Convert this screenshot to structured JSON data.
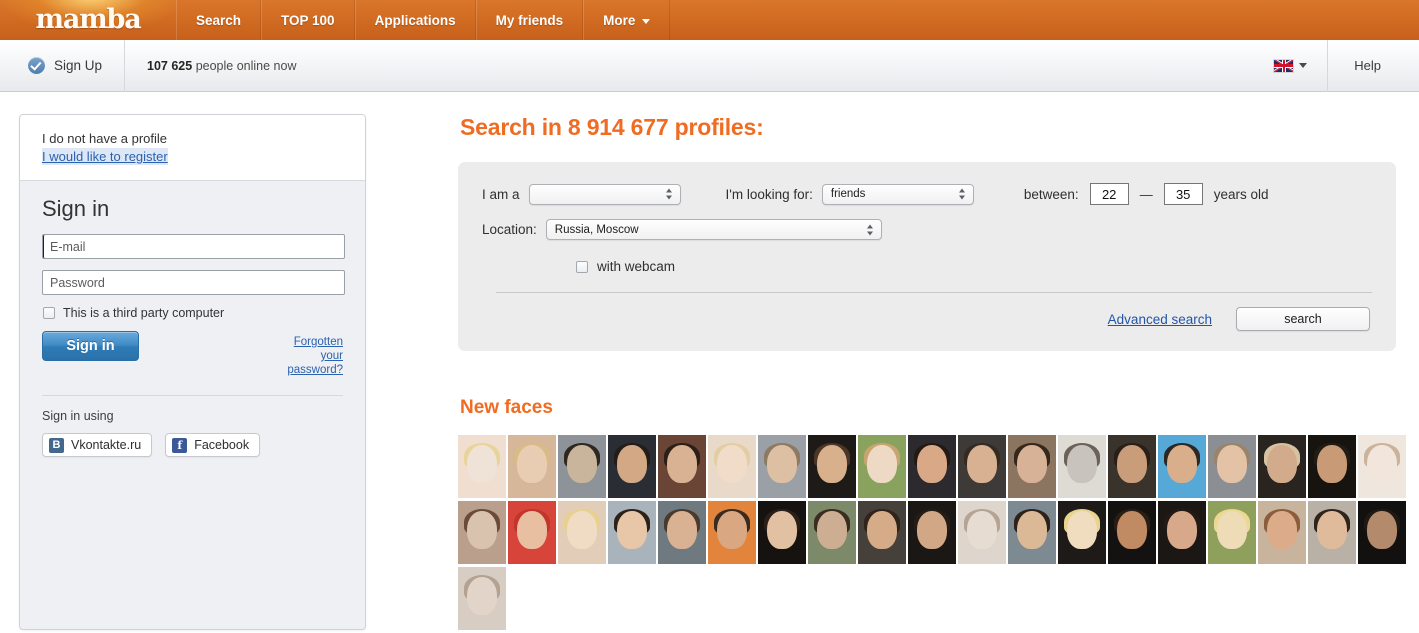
{
  "nav": {
    "logo": "mamba",
    "items": [
      {
        "label": "Search",
        "icon": null
      },
      {
        "label": "TOP 100",
        "icon": null
      },
      {
        "label": "Applications",
        "icon": null
      },
      {
        "label": "My friends",
        "icon": null
      },
      {
        "label": "More",
        "icon": "chevron-down-icon"
      }
    ]
  },
  "subbar": {
    "signup_label": "Sign Up",
    "signup_icon": "check-circle-icon",
    "online_count": "107 625",
    "online_text": "people online now",
    "lang_icon": "uk-flag-icon",
    "lang_caret_icon": "chevron-down-icon",
    "help_label": "Help"
  },
  "login": {
    "no_profile_text": "I do not have a profile",
    "register_link": "I would like to register",
    "title": "Sign in",
    "email_placeholder": "E-mail",
    "email_value": "",
    "password_placeholder": "Password",
    "password_value": "",
    "third_party_label": "This is a third party computer",
    "third_party_checked": false,
    "signin_button": "Sign in",
    "forgotten_link": "Forgotten your password?",
    "sign_in_using": "Sign in using",
    "social": [
      {
        "label": "Vkontakte.ru",
        "glyph": "B",
        "icon": "vkontakte-icon"
      },
      {
        "label": "Facebook",
        "glyph": "f",
        "icon": "facebook-icon"
      }
    ]
  },
  "search": {
    "title": "Search in 8 914 677 profiles:",
    "profiles_count": "8 914 677",
    "i_am_a_label": "I am a",
    "i_am_a_value": "",
    "looking_for_label": "I'm looking for:",
    "looking_for_value": "friends",
    "between_label": "between:",
    "age_from": "22",
    "age_dash": "—",
    "age_to": "35",
    "years_old_label": "years old",
    "location_label": "Location:",
    "location_value": "Russia, Moscow",
    "webcam_label": "with webcam",
    "webcam_checked": false,
    "advanced_link": "Advanced search",
    "search_button": "search"
  },
  "new_faces": {
    "title": "New faces",
    "thumbnails": [
      {
        "id": 1,
        "skin": "#efe2d6",
        "hair": "#e8d49a",
        "body": "#f0dfd0",
        "highlight": false
      },
      {
        "id": 2,
        "skin": "#e9cdb3",
        "hair": "#d9bb85",
        "body": "#d7b79a",
        "highlight": false
      },
      {
        "id": 3,
        "skin": "#c9b49c",
        "hair": "#2e2820",
        "body": "#8e9299",
        "highlight": false
      },
      {
        "id": 4,
        "skin": "#d3a884",
        "hair": "#241c16",
        "body": "#2a2d33",
        "highlight": true
      },
      {
        "id": 5,
        "skin": "#d8b292",
        "hair": "#2b1f18",
        "body": "#6a4434",
        "highlight": false
      },
      {
        "id": 6,
        "skin": "#f0dcc9",
        "hair": "#e3cda4",
        "body": "#e8d9c9",
        "highlight": false
      },
      {
        "id": 7,
        "skin": "#ddbfa4",
        "hair": "#8d7a62",
        "body": "#9aa0a6",
        "highlight": false
      },
      {
        "id": 8,
        "skin": "#d8b08c",
        "hair": "#4b3526",
        "body": "#1e1a17",
        "highlight": false
      },
      {
        "id": 9,
        "skin": "#eedac4",
        "hair": "#c8a470",
        "body": "#89a35e",
        "highlight": true
      },
      {
        "id": 10,
        "skin": "#d8a887",
        "hair": "#231a14",
        "body": "#2c2a2e",
        "highlight": true
      },
      {
        "id": 11,
        "skin": "#d7b191",
        "hair": "#342a22",
        "body": "#3d3a38",
        "highlight": false
      },
      {
        "id": 12,
        "skin": "#d8b296",
        "hair": "#35271c",
        "body": "#8c7560",
        "highlight": false
      },
      {
        "id": 13,
        "skin": "#c8c3bc",
        "hair": "#6a6158",
        "body": "#dedad4",
        "highlight": false
      },
      {
        "id": 14,
        "skin": "#c99d79",
        "hair": "#2a1f18",
        "body": "#3a332c",
        "highlight": false
      },
      {
        "id": 15,
        "skin": "#d8ae8b",
        "hair": "#2b2723",
        "body": "#56a8d6",
        "highlight": false
      },
      {
        "id": 16,
        "skin": "#e4c2a6",
        "hair": "#9a8469",
        "body": "#8b8f94",
        "highlight": false
      },
      {
        "id": 17,
        "skin": "#d2ab8c",
        "hair": "#d6c3a4",
        "body": "#2a2420",
        "highlight": false
      },
      {
        "id": 18,
        "skin": "#c89a76",
        "hair": "#241b15",
        "body": "#17140f",
        "highlight": true
      },
      {
        "id": 19,
        "skin": "#f2e6dc",
        "hair": "#cbb39b",
        "body": "#efe6de",
        "highlight": false
      },
      {
        "id": 20,
        "skin": "#d9c2ae",
        "hair": "#6a4b38",
        "body": "#b99f8c",
        "highlight": false
      },
      {
        "id": 21,
        "skin": "#e8bfa0",
        "hair": "#c2352c",
        "body": "#d6443a",
        "highlight": false
      },
      {
        "id": 22,
        "skin": "#f0dcc4",
        "hair": "#ead08f",
        "body": "#e2cdb8",
        "highlight": false
      },
      {
        "id": 23,
        "skin": "#e7c7a8",
        "hair": "#2d2219",
        "body": "#a9b3bb",
        "highlight": false
      },
      {
        "id": 24,
        "skin": "#d9b193",
        "hair": "#4a3a2c",
        "body": "#6f7a80",
        "highlight": false
      },
      {
        "id": 25,
        "skin": "#d9a781",
        "hair": "#3a2b20",
        "body": "#e2843c",
        "highlight": true
      },
      {
        "id": 26,
        "skin": "#e2c0a2",
        "hair": "#2b1f18",
        "body": "#15120f",
        "highlight": false
      },
      {
        "id": 27,
        "skin": "#cdae93",
        "hair": "#3b2c22",
        "body": "#7c8a6a",
        "highlight": false
      },
      {
        "id": 28,
        "skin": "#d6ac88",
        "hair": "#2f241b",
        "body": "#46403a",
        "highlight": false
      },
      {
        "id": 29,
        "skin": "#d2a785",
        "hair": "#241c15",
        "body": "#1b1714",
        "highlight": true
      },
      {
        "id": 30,
        "skin": "#e6dcd2",
        "hair": "#b5a394",
        "body": "#ded6cc",
        "highlight": false
      },
      {
        "id": 31,
        "skin": "#dcb996",
        "hair": "#2d2119",
        "body": "#7e8a92",
        "highlight": false
      },
      {
        "id": 32,
        "skin": "#f0dcbe",
        "hair": "#e9d48f",
        "body": "#1d1a17",
        "highlight": false
      },
      {
        "id": 33,
        "skin": "#c08a62",
        "hair": "#2a1d14",
        "body": "#141210",
        "highlight": false
      },
      {
        "id": 34,
        "skin": "#d8a88a",
        "hair": "#241a14",
        "body": "#1a1714",
        "highlight": false
      },
      {
        "id": 35,
        "skin": "#eddcb6",
        "hair": "#ecd795",
        "body": "#8fa05c",
        "highlight": false
      },
      {
        "id": 36,
        "skin": "#dcab8a",
        "hair": "#8b5d3c",
        "body": "#c8b49c",
        "highlight": false
      },
      {
        "id": 37,
        "skin": "#e0bb9b",
        "hair": "#2f241c",
        "body": "#b9b0a6",
        "highlight": false
      },
      {
        "id": 38,
        "skin": "#b48a6c",
        "hair": "#1f1813",
        "body": "#131110",
        "highlight": true
      },
      {
        "id": 39,
        "skin": "#e2d4c8",
        "hair": "#b3a292",
        "body": "#d8cdc2",
        "highlight": false
      }
    ]
  },
  "colors": {
    "brand_orange": "#ef6c22",
    "nav_orange": "#cf6a1d",
    "link_blue": "#2255a8",
    "button_blue": "#3f8ac4",
    "panel_gray": "#ececec",
    "highlight_border": "#e8a64e"
  }
}
